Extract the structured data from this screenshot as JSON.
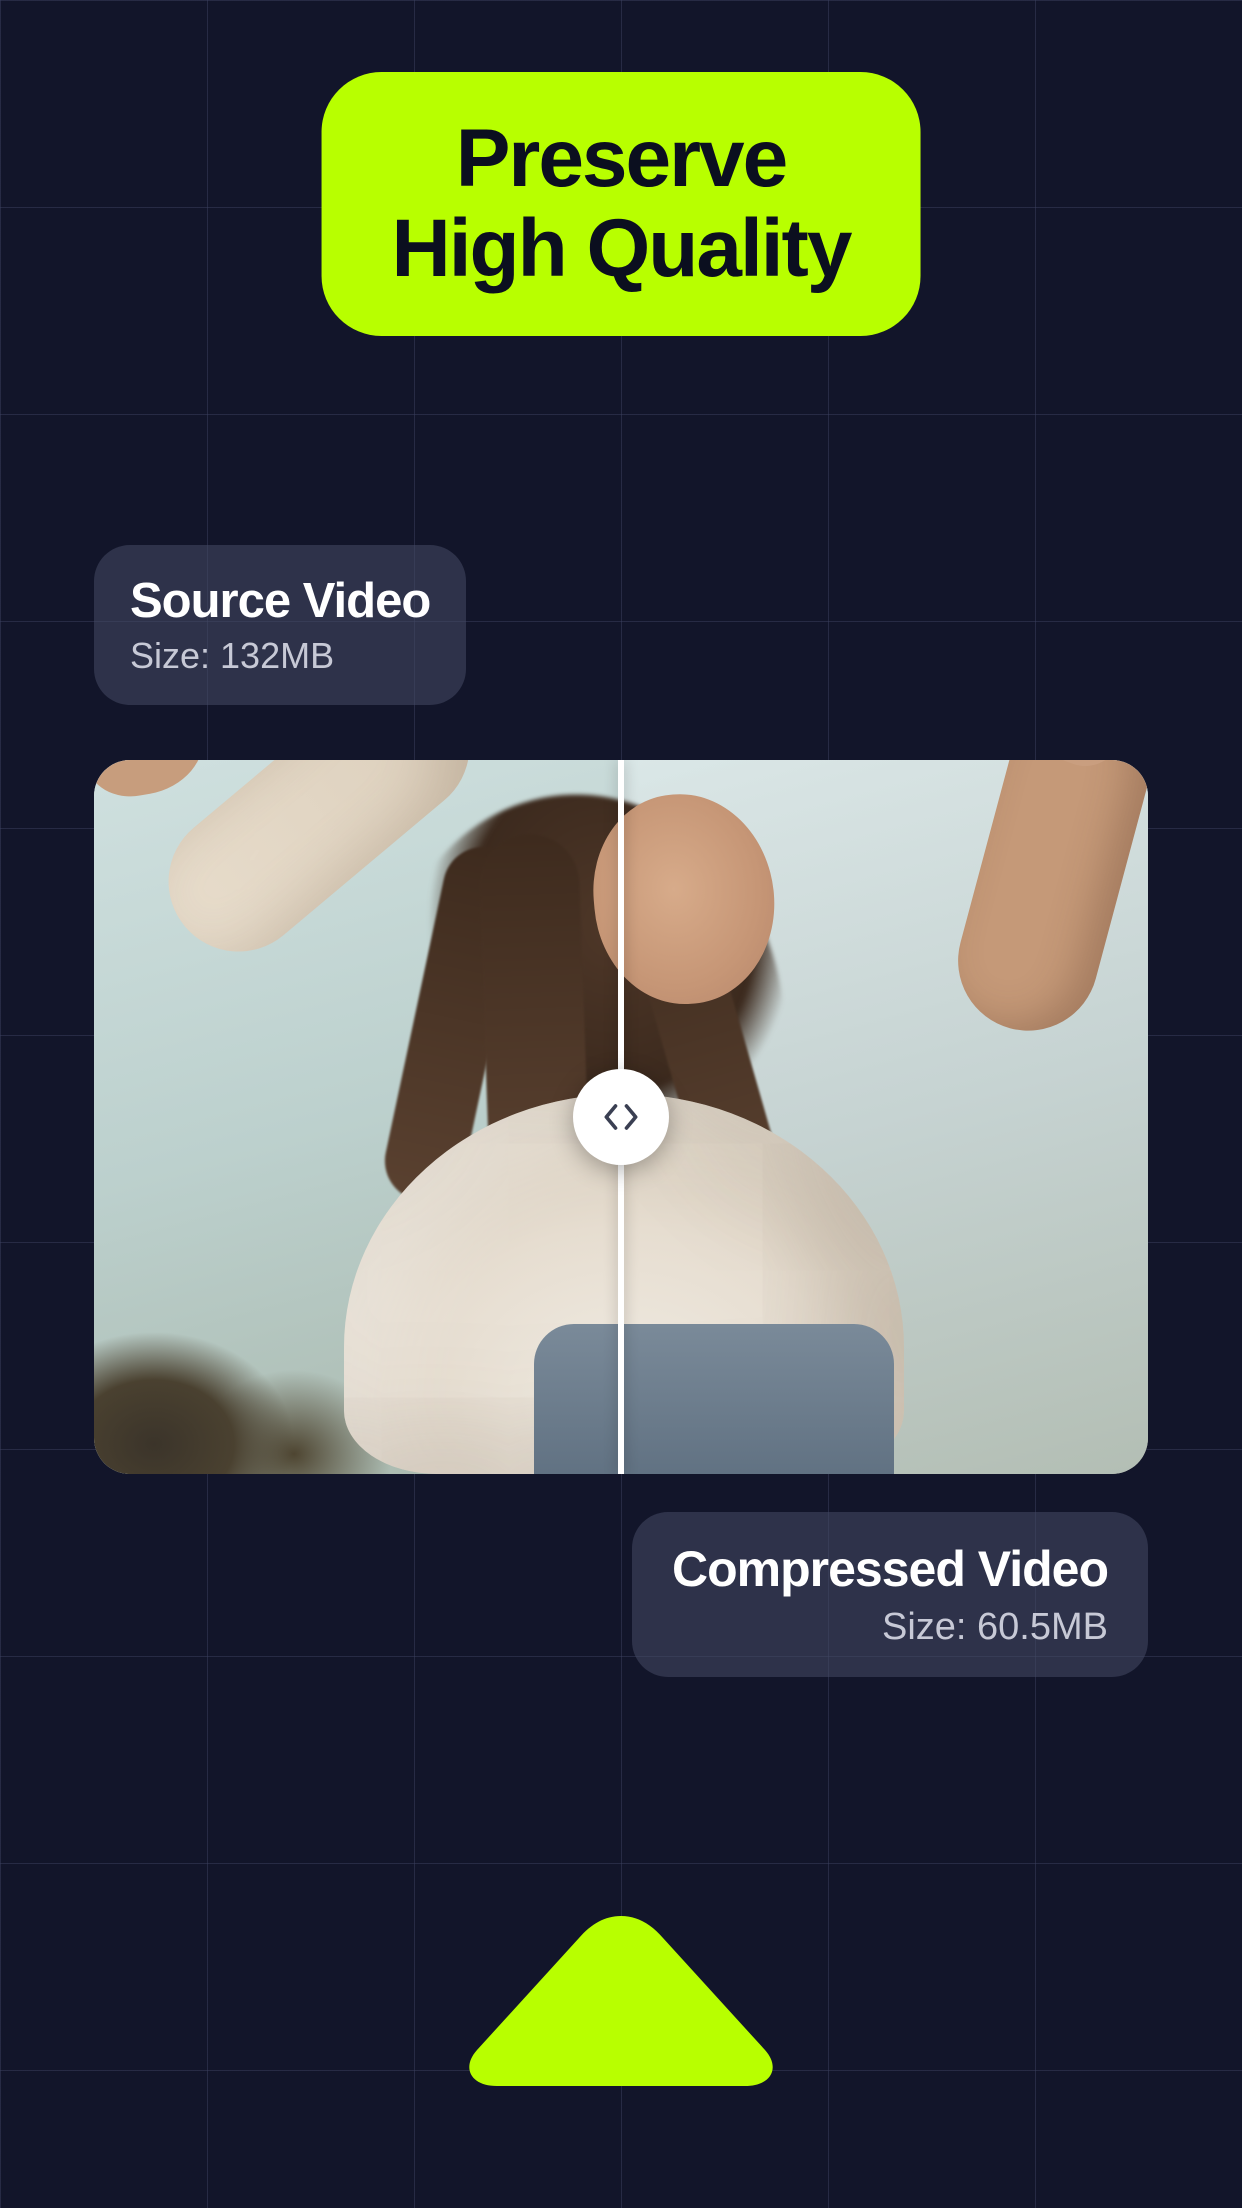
{
  "headline": {
    "line1": "Preserve",
    "line2": "High Quality"
  },
  "source": {
    "title": "Source Video",
    "size_label": "Size: 132MB"
  },
  "compressed": {
    "title": "Compressed Video",
    "size_label": "Size: 60.5MB"
  },
  "colors": {
    "accent": "#b8ff00",
    "bg": "#12152a"
  },
  "icons": {
    "compare_slider": "compare-slider-icon",
    "arrow_up": "arrow-up-icon"
  }
}
